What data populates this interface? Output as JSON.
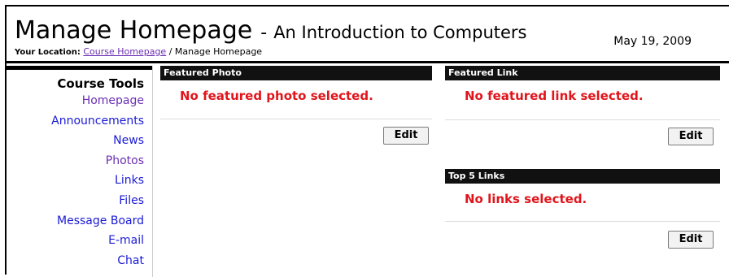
{
  "header": {
    "title": "Manage Homepage",
    "separator": "-",
    "subtitle": "An Introduction to Computers",
    "date": "May 19, 2009",
    "breadcrumb": {
      "label": "Your Location:",
      "link": "Course Homepage",
      "separator": "/",
      "current": "Manage Homepage"
    }
  },
  "sidebar": {
    "title": "Course Tools",
    "items": [
      {
        "label": "Homepage"
      },
      {
        "label": "Announcements"
      },
      {
        "label": "News"
      },
      {
        "label": "Photos"
      },
      {
        "label": "Links"
      },
      {
        "label": "Files"
      },
      {
        "label": "Message Board"
      },
      {
        "label": "E-mail"
      },
      {
        "label": "Chat"
      }
    ]
  },
  "featured_photo": {
    "header": "Featured Photo",
    "message": "No featured photo selected.",
    "edit_label": "Edit"
  },
  "featured_link": {
    "header": "Featured Link",
    "message": "No featured link selected.",
    "edit_label": "Edit"
  },
  "top_links": {
    "header": "Top 5 Links",
    "message": "No links selected.",
    "edit_label": "Edit"
  },
  "colors": {
    "header_bar": "#111111",
    "alert_text": "#e0151b",
    "link": "#1a1ad6",
    "visited_link": "#6b2fb3"
  }
}
